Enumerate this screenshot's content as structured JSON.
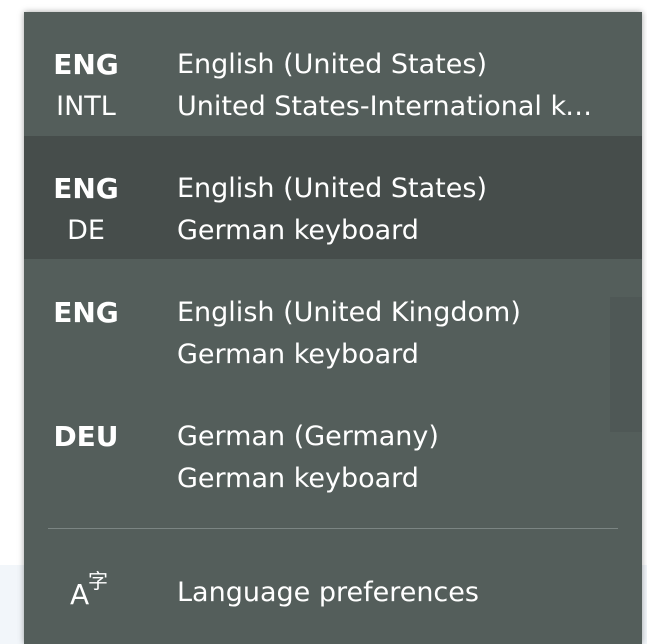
{
  "languages": [
    {
      "code": "ENG",
      "layout": "INTL",
      "name": "English (United States)",
      "keyboard": "United States-International keyboard",
      "selected": false
    },
    {
      "code": "ENG",
      "layout": "DE",
      "name": "English (United States)",
      "keyboard": "German keyboard",
      "selected": true
    },
    {
      "code": "ENG",
      "layout": "",
      "name": "English (United Kingdom)",
      "keyboard": "German keyboard",
      "selected": false
    },
    {
      "code": "DEU",
      "layout": "",
      "name": "German (Germany)",
      "keyboard": "German keyboard",
      "selected": false
    }
  ],
  "preferences": {
    "label": "Language preferences",
    "icon": "language-icon",
    "icon_glyph_a": "A",
    "icon_glyph_zi": "字"
  },
  "colors": {
    "flyout_bg": "#545e5b",
    "selected_bg": "#464d4b",
    "text": "#ffffff",
    "divider": "#7b8583"
  }
}
